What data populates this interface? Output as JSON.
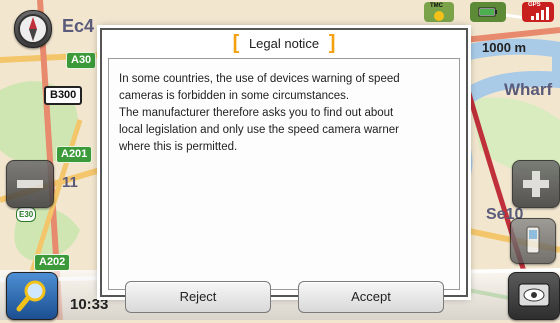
{
  "dialog": {
    "title": "Legal notice",
    "message": "In some countries, the use of devices warning of speed\ncameras is forbidden in some circumstances.\nThe manufacturer therefore asks you to find out about\nlocal legislation and only use the speed camera warner\nwhere this is permitted.",
    "reject_label": "Reject",
    "accept_label": "Accept"
  },
  "map": {
    "road_labels": [
      "A30",
      "B300",
      "A201",
      "A202",
      "E30"
    ],
    "partial_labels": [
      "Ec4",
      "11",
      "Se10"
    ],
    "place_wharf": "Wharf",
    "scale": "1000 m"
  },
  "status_bar": {
    "tmc_label": "TMC",
    "gps_label": "GPS",
    "time": "10:33"
  },
  "colors": {
    "accent": "#f3a011",
    "dialog_border": "#555555",
    "map_land": "#f2e6cf",
    "water": "#a9cbe8",
    "route": "#c0303a"
  },
  "icons": [
    "compass-icon",
    "tmc-icon",
    "battery-icon",
    "gps-signal-icon",
    "zoom-in-icon",
    "zoom-out-icon",
    "search-icon",
    "view-icon",
    "phone-icon"
  ]
}
